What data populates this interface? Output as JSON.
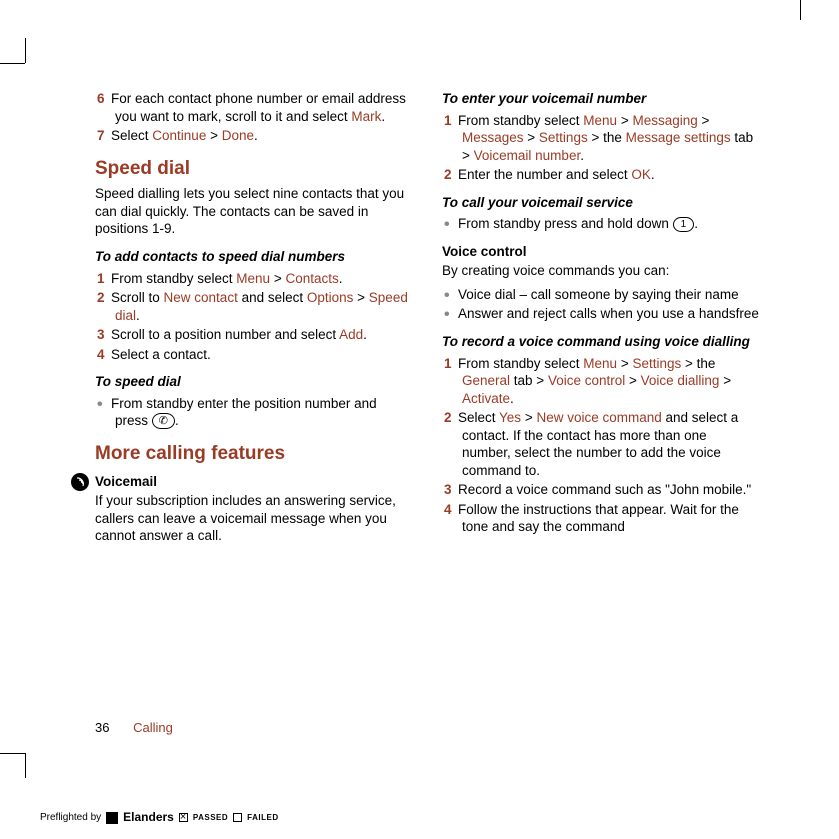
{
  "left": {
    "step6_a": "For each contact phone number or email address you want to mark, scroll to it and select ",
    "mark": "Mark",
    "step7_a": "Select ",
    "continue": "Continue",
    "done": "Done",
    "speed_h": "Speed dial",
    "speed_p": "Speed dialling lets you select nine contacts that you can dial quickly. The contacts can be saved in positions 1-9.",
    "add_h": "To add contacts to speed dial numbers",
    "a1_a": "From standby select ",
    "menu": "Menu",
    "contacts": "Contacts",
    "a2_a": "Scroll to ",
    "newcontact": "New contact",
    "a2_b": " and select ",
    "options": "Options",
    "speeddial": "Speed dial",
    "a3_a": "Scroll to a position number and select ",
    "add": "Add",
    "a4": "Select a contact.",
    "tosd_h": "To speed dial",
    "tosd_b": "From standby enter the position number and press ",
    "more_h": "More calling features",
    "vm_h": "Voicemail",
    "vm_p": "If your subscription includes an answering service, callers can leave a voicemail message when you cannot answer a call."
  },
  "right": {
    "enter_h": "To enter your voicemail number",
    "e1_a": "From standby select ",
    "menu": "Menu",
    "messaging": "Messaging",
    "messages": "Messages",
    "settings": "Settings",
    "e1_b": " > the ",
    "msgset": "Message settings",
    "e1_c": " tab > ",
    "vmnum": "Voicemail number",
    "e2_a": "Enter the number and select ",
    "ok": "OK",
    "call_h": "To call your voicemail service",
    "call_b": "From standby press and hold down ",
    "vc_h": "Voice control",
    "vc_p": "By creating voice commands you can:",
    "vc_b1": "Voice dial – call someone by saying their name",
    "vc_b2": "Answer and reject calls when you use a handsfree",
    "rec_h": "To record a voice command using voice dialling",
    "r1_a": "From standby select ",
    "r1_b": " > the ",
    "general": "General",
    "r1_c": " tab > ",
    "vcontrol": "Voice control",
    "vdial": "Voice dialling",
    "activate": "Activate",
    "r2_a": "Select ",
    "yes": "Yes",
    "nvc": "New voice command",
    "r2_b": " and select a contact. If the contact has more than one number, select the number to add the voice command to.",
    "r3": "Record a voice command such as \"John mobile.\"",
    "r4": "Follow the instructions that appear. Wait for the tone and say the command"
  },
  "footer": {
    "page": "36",
    "section": "Calling"
  },
  "preflight": {
    "label": "Preflighted by",
    "brand": "Elanders",
    "passed": "PASSED",
    "failed": "FAILED"
  },
  "nums": {
    "n1": "1",
    "n2": "2",
    "n3": "3",
    "n4": "4",
    "n6": "6",
    "n7": "7"
  }
}
